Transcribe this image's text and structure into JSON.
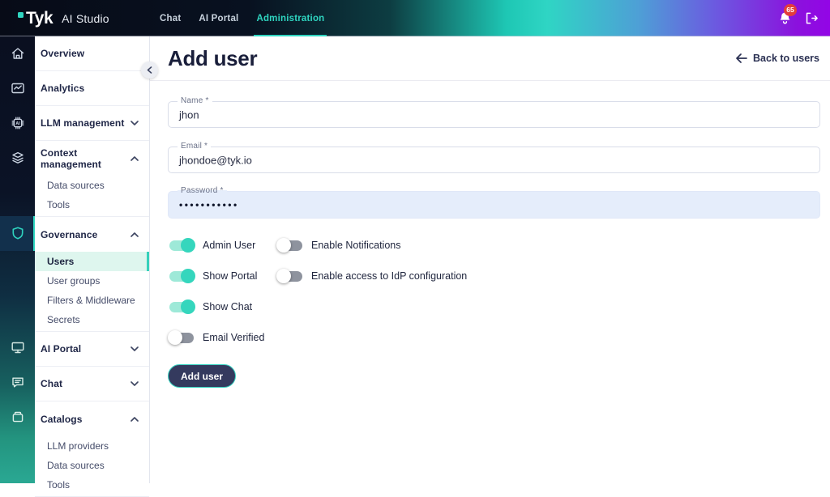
{
  "topbar": {
    "brand": "Tyk",
    "product": "AI Studio",
    "nav": [
      {
        "label": "Chat",
        "active": false
      },
      {
        "label": "AI Portal",
        "active": false
      },
      {
        "label": "Administration",
        "active": true
      }
    ],
    "notification_count": "65"
  },
  "rail": {
    "icons": [
      "home",
      "analytics",
      "ai-chip",
      "layers",
      "shield",
      "monitor",
      "chat-bubble",
      "catalog-box"
    ],
    "active_icon": "shield"
  },
  "sidebar": {
    "items": [
      {
        "label": "Overview"
      },
      {
        "label": "Analytics"
      },
      {
        "label": "LLM management",
        "chevron": "down"
      },
      {
        "label": "Context management",
        "chevron": "up",
        "children": [
          "Data sources",
          "Tools"
        ]
      },
      {
        "label": "Governance",
        "chevron": "up",
        "children": [
          "Users",
          "User groups",
          "Filters & Middleware",
          "Secrets"
        ],
        "active_child": "Users"
      },
      {
        "label": "AI Portal",
        "chevron": "down"
      },
      {
        "label": "Chat",
        "chevron": "down"
      },
      {
        "label": "Catalogs",
        "chevron": "up",
        "children": [
          "LLM providers",
          "Data sources",
          "Tools"
        ]
      }
    ]
  },
  "main": {
    "title": "Add user",
    "back_label": "Back to users",
    "form": {
      "fields": [
        {
          "label": "Name *",
          "value": "jhon"
        },
        {
          "label": "Email *",
          "value": "jhondoe@tyk.io"
        },
        {
          "label": "Password *",
          "value": "•••••••••••"
        }
      ],
      "toggles": [
        {
          "label": "Admin User",
          "on": true
        },
        {
          "label": "Enable Notifications",
          "on": false
        },
        {
          "label": "Show Portal",
          "on": true
        },
        {
          "label": "Enable access to IdP configuration",
          "on": false
        },
        {
          "label": "Show Chat",
          "on": true
        },
        {
          "label": "Email Verified",
          "on": false
        }
      ],
      "submit_label": "Add user"
    }
  },
  "colors": {
    "accent_teal": "#2fd5c0",
    "badge_red": "#e23d3d",
    "active_item_bg": "#def6ee",
    "password_field_bg": "#e5edfb",
    "button_bg": "#343a5e"
  }
}
